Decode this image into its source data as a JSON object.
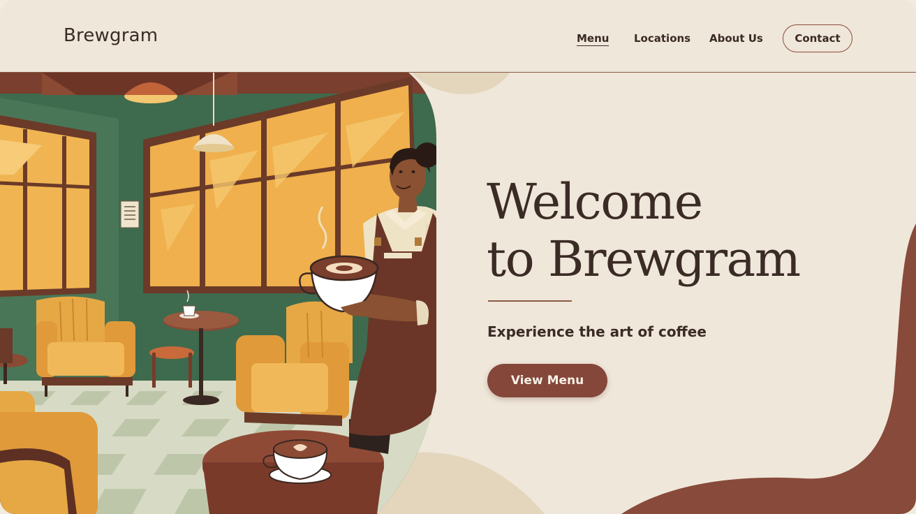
{
  "brand": {
    "logo": "Brewgram"
  },
  "nav": {
    "menu": "Menu",
    "locations": "Locations",
    "about": "About Us",
    "contact": "Contact",
    "active": "Menu"
  },
  "hero": {
    "title_line1": "Welcome",
    "title_line2": "to Brewgram",
    "subtitle": "Experience the art of coffee",
    "cta": "View Menu",
    "illustration_icon": "barista-cafe-illustration"
  },
  "colors": {
    "background": "#efe7da",
    "accent": "#84473a",
    "text": "#3b2b25",
    "wall_green": "#3f6a4f",
    "armchair_mustard": "#e2a443"
  }
}
